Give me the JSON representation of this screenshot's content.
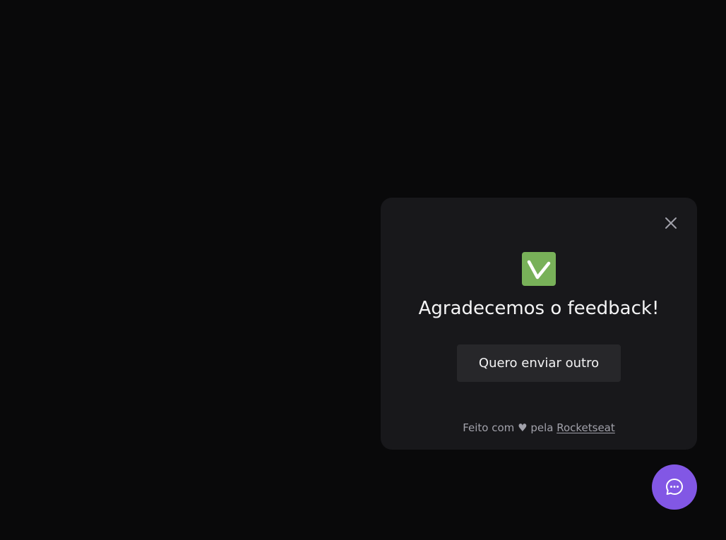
{
  "widget": {
    "title": "Agradecemos o feedback!",
    "restart_button_label": "Quero enviar outro",
    "footer": {
      "prefix": "Feito com",
      "heart": "♥",
      "middle": "pela",
      "link_text": "Rocketseat"
    },
    "close_icon": "close-icon",
    "success_icon": "check-mark-icon"
  },
  "fab": {
    "icon": "chat-bubble-icon"
  },
  "colors": {
    "background": "#09090a",
    "card": "#18181b",
    "button": "#27272a",
    "brand": "#8257e5",
    "success": "#78b159",
    "text": "#f4f4f5",
    "muted": "#a1a1aa"
  }
}
